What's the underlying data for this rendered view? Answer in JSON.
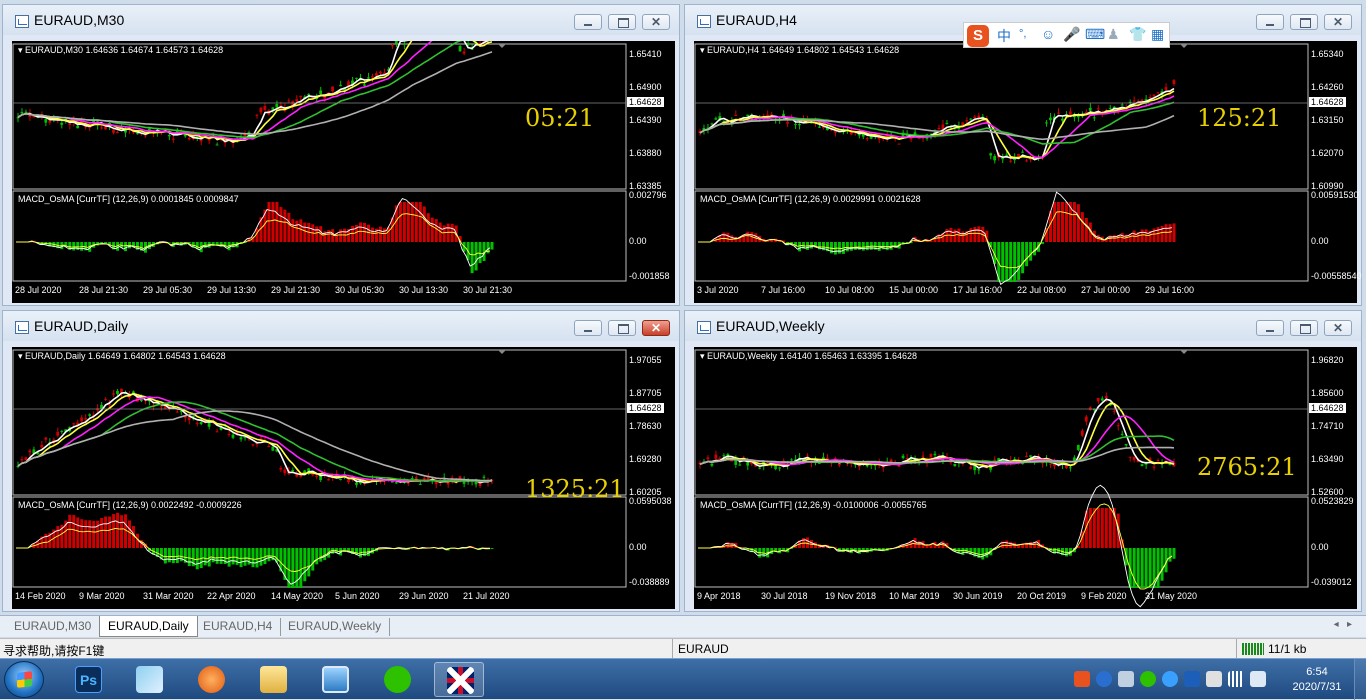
{
  "colors": {
    "candle_up": "#00c000",
    "candle_down": "#d00000",
    "ma_white": "#ffffff",
    "ma_yellow": "#ffff40",
    "ma_magenta": "#ff20ff",
    "ma_green": "#30c030",
    "ma_gray": "#b0b0b0",
    "countdown": "#e8d000",
    "chart_bg": "#000000"
  },
  "windows": [
    {
      "title": "EURAUD,M30",
      "header": "EURAUD,M30  1.64636 1.64674 1.64573 1.64628",
      "macd_header": "MACD_OsMA [CurrTF] (12,26,9) 0.0001845 0.0009847",
      "prices": [
        "1.65410",
        "1.64900",
        "1.64390",
        "1.63880",
        "1.63385"
      ],
      "current_price": "1.64628",
      "macd_scale": [
        "0.002796",
        "0.00",
        "-0.001858"
      ],
      "times": [
        "28 Jul 2020",
        "28 Jul 21:30",
        "29 Jul 05:30",
        "29 Jul 13:30",
        "29 Jul 21:30",
        "30 Jul 05:30",
        "30 Jul 13:30",
        "30 Jul 21:30"
      ],
      "countdown": "05:21",
      "close_active": false
    },
    {
      "title": "EURAUD,H4",
      "header": "EURAUD,H4  1.64649 1.64802 1.64543 1.64628",
      "macd_header": "MACD_OsMA [CurrTF] (12,26,9) 0.0029991 0.0021628",
      "prices": [
        "1.65340",
        "1.64260",
        "1.63150",
        "1.62070",
        "1.60990"
      ],
      "current_price": "1.64628",
      "macd_scale": [
        "0.00591530",
        "0.00",
        "-0.00558540"
      ],
      "times": [
        "3 Jul 2020",
        "7 Jul 16:00",
        "10 Jul 08:00",
        "15 Jul 00:00",
        "17 Jul 16:00",
        "22 Jul 08:00",
        "27 Jul 00:00",
        "29 Jul 16:00"
      ],
      "countdown": "125:21",
      "close_active": false
    },
    {
      "title": "EURAUD,Daily",
      "header": "EURAUD,Daily  1.64649 1.64802 1.64543 1.64628",
      "macd_header": "MACD_OsMA [CurrTF] (12,26,9) 0.0022492 -0.0009226",
      "prices": [
        "1.97055",
        "1.87705",
        "1.78630",
        "1.69280",
        "1.60205"
      ],
      "current_price": "1.64628",
      "macd_scale": [
        "0.0595038",
        "0.00",
        "-0.038889"
      ],
      "times": [
        "14 Feb 2020",
        "9 Mar 2020",
        "31 Mar 2020",
        "22 Apr 2020",
        "14 May 2020",
        "5 Jun 2020",
        "29 Jun 2020",
        "21 Jul 2020"
      ],
      "countdown": "1325:21",
      "close_active": true
    },
    {
      "title": "EURAUD,Weekly",
      "header": "EURAUD,Weekly  1.64140 1.65463 1.63395 1.64628",
      "macd_header": "MACD_OsMA [CurrTF] (12,26,9) -0.0100006 -0.0055765",
      "prices": [
        "1.96820",
        "1.85600",
        "1.74710",
        "1.63490",
        "1.52600"
      ],
      "current_price": "1.64628",
      "macd_scale": [
        "0.0523829",
        "0.00",
        "-0.039012"
      ],
      "times": [
        "9 Apr 2018",
        "30 Jul 2018",
        "19 Nov 2018",
        "10 Mar 2019",
        "30 Jun 2019",
        "20 Oct 2019",
        "9 Feb 2020",
        "31 May 2020"
      ],
      "countdown": "2765:21",
      "close_active": false
    }
  ],
  "tabs": [
    "EURAUD,M30",
    "EURAUD,Daily",
    "EURAUD,H4",
    "EURAUD,Weekly"
  ],
  "active_tab": 1,
  "status": {
    "help": "寻求帮助,请按F1键",
    "symbol": "EURAUD",
    "traffic": "11/1 kb"
  },
  "ime": {
    "items": [
      "中",
      "°,"
    ]
  },
  "taskbar": {
    "apps": [
      "Ps"
    ],
    "clock_time": "6:54",
    "clock_date": "2020/7/31"
  }
}
